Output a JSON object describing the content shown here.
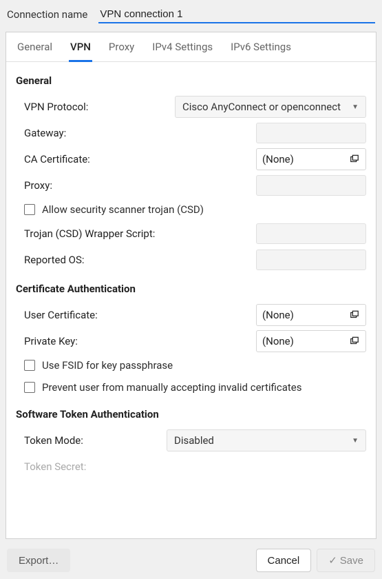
{
  "header": {
    "connection_name_label": "Connection name",
    "connection_name_value": "VPN connection 1"
  },
  "tabs": {
    "general": "General",
    "vpn": "VPN",
    "proxy": "Proxy",
    "ipv4": "IPv4 Settings",
    "ipv6": "IPv6 Settings",
    "active": "vpn"
  },
  "sections": {
    "general": {
      "title": "General",
      "vpn_protocol_label": "VPN Protocol:",
      "vpn_protocol_value": "Cisco AnyConnect or openconnect",
      "gateway_label": "Gateway:",
      "gateway_value": "",
      "ca_cert_label": "CA Certificate:",
      "ca_cert_value": "(None)",
      "proxy_label": "Proxy:",
      "proxy_value": "",
      "allow_csd_label": "Allow security scanner trojan (CSD)",
      "csd_wrapper_label": "Trojan (CSD) Wrapper Script:",
      "csd_wrapper_value": "",
      "reported_os_label": "Reported OS:",
      "reported_os_value": ""
    },
    "cert_auth": {
      "title": "Certificate Authentication",
      "user_cert_label": "User Certificate:",
      "user_cert_value": "(None)",
      "private_key_label": "Private Key:",
      "private_key_value": "(None)",
      "use_fsid_label": "Use FSID for key passphrase",
      "prevent_invalid_label": "Prevent user from manually accepting invalid certificates"
    },
    "token": {
      "title": "Software Token Authentication",
      "token_mode_label": "Token Mode:",
      "token_mode_value": "Disabled",
      "token_secret_label": "Token Secret:",
      "token_secret_value": ""
    }
  },
  "buttons": {
    "export": "Export…",
    "cancel": "Cancel",
    "save": "Save"
  }
}
